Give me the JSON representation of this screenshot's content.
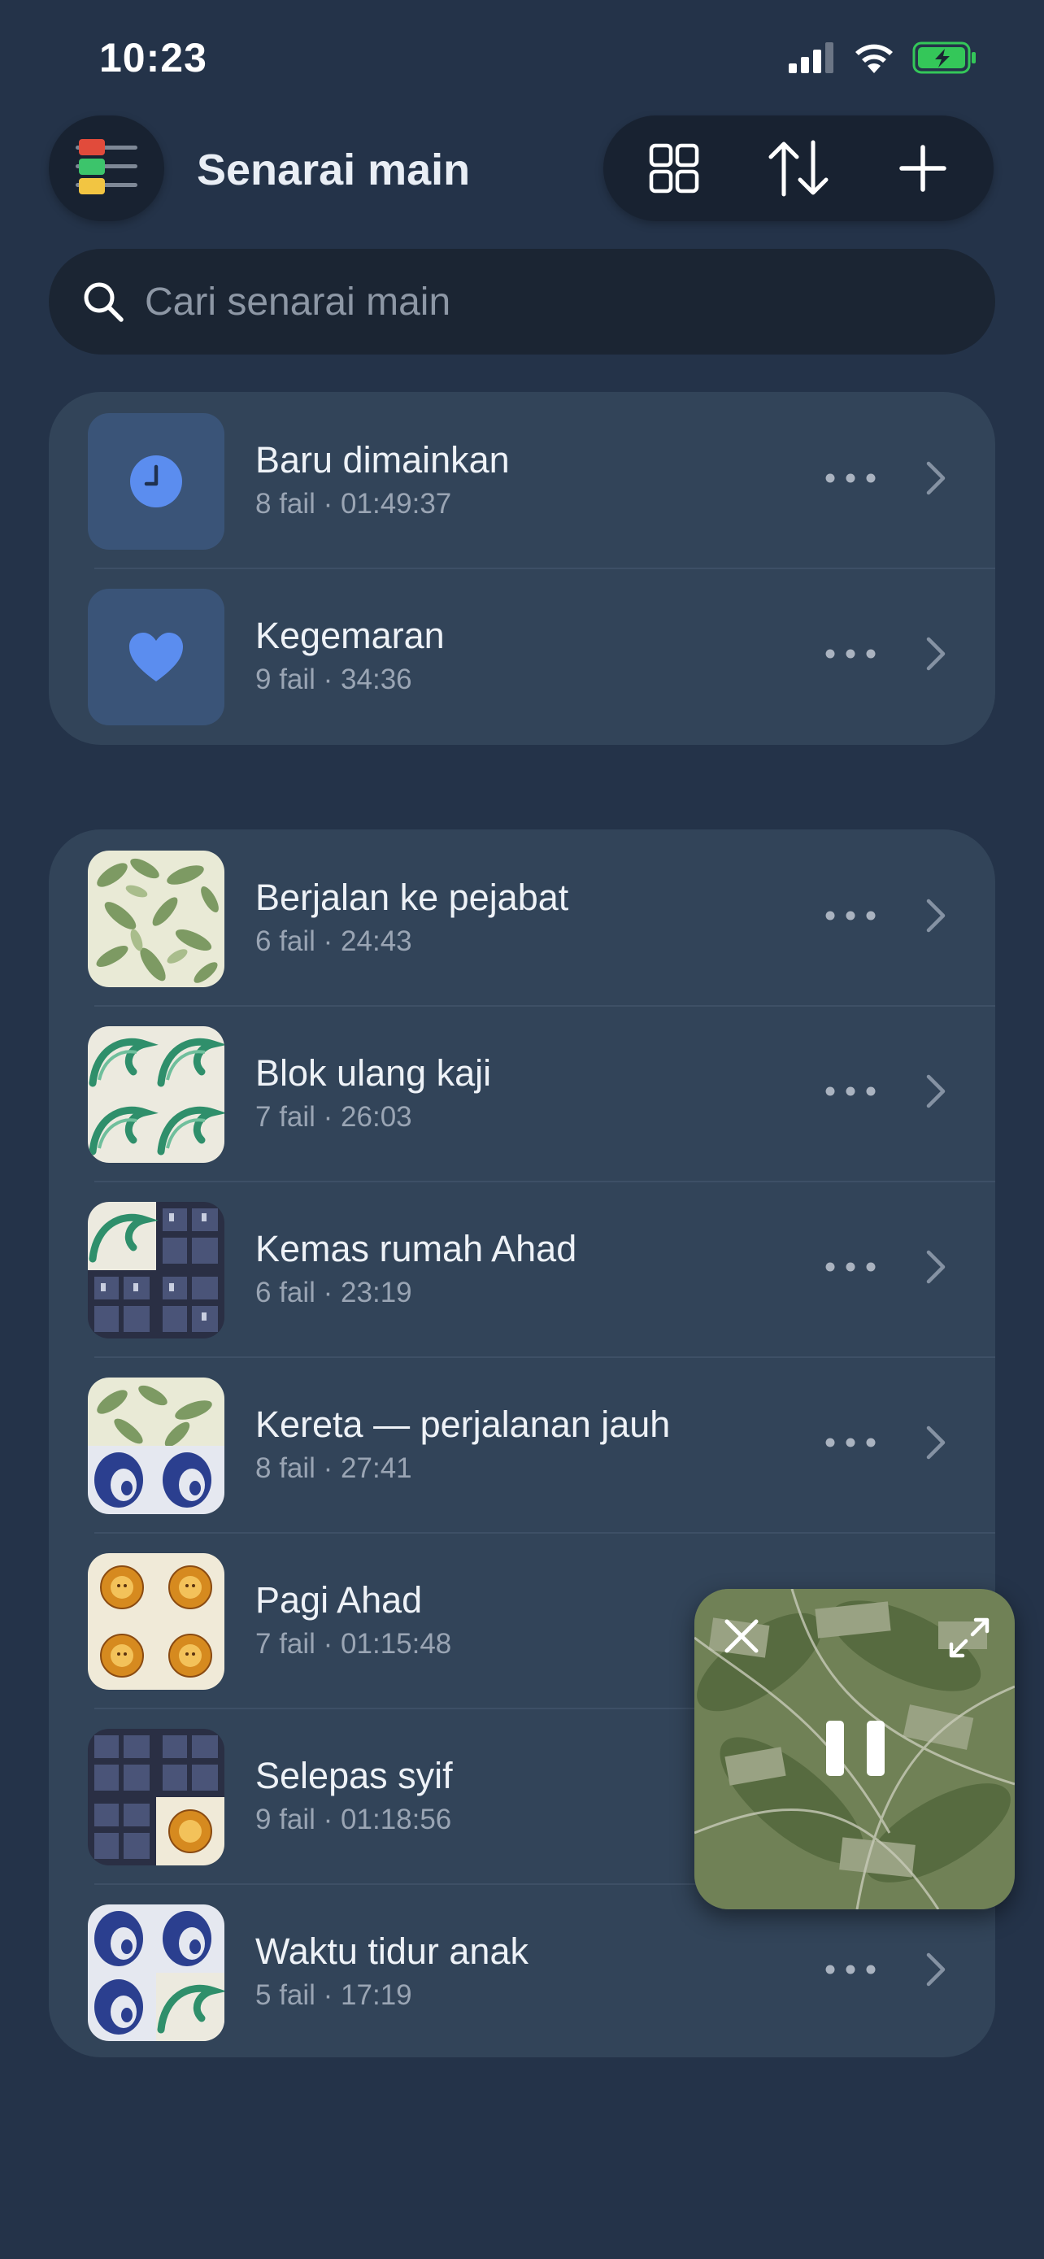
{
  "status": {
    "time": "10:23"
  },
  "header": {
    "title": "Senarai main",
    "menu_icon": "playlist-menu-icon",
    "actions": [
      "grid-view-icon",
      "sort-icon",
      "add-icon"
    ]
  },
  "search": {
    "placeholder": "Cari senarai main",
    "value": ""
  },
  "smart_lists": [
    {
      "title": "Baru dimainkan",
      "meta": "8 fail · 01:49:37",
      "icon": "clock-icon"
    },
    {
      "title": "Kegemaran",
      "meta": "9 fail · 34:36",
      "icon": "heart-icon"
    }
  ],
  "playlists": [
    {
      "title": "Berjalan ke pejabat",
      "meta": "6 fail · 24:43"
    },
    {
      "title": "Blok ulang kaji",
      "meta": "7 fail · 26:03"
    },
    {
      "title": "Kemas rumah Ahad",
      "meta": "6 fail · 23:19"
    },
    {
      "title": "Kereta — perjalanan jauh",
      "meta": "8 fail · 27:41"
    },
    {
      "title": "Pagi Ahad",
      "meta": "7 fail · 01:15:48"
    },
    {
      "title": "Selepas syif",
      "meta": "9 fail · 01:18:56"
    },
    {
      "title": "Waktu tidur anak",
      "meta": "5 fail · 17:19"
    }
  ],
  "mini_player": {
    "state": "playing",
    "controls": [
      "close-icon",
      "expand-icon",
      "pause-icon"
    ]
  },
  "colors": {
    "background": "#243349",
    "card": "#324459",
    "accent": "#5b8def",
    "battery": "#34c759"
  }
}
